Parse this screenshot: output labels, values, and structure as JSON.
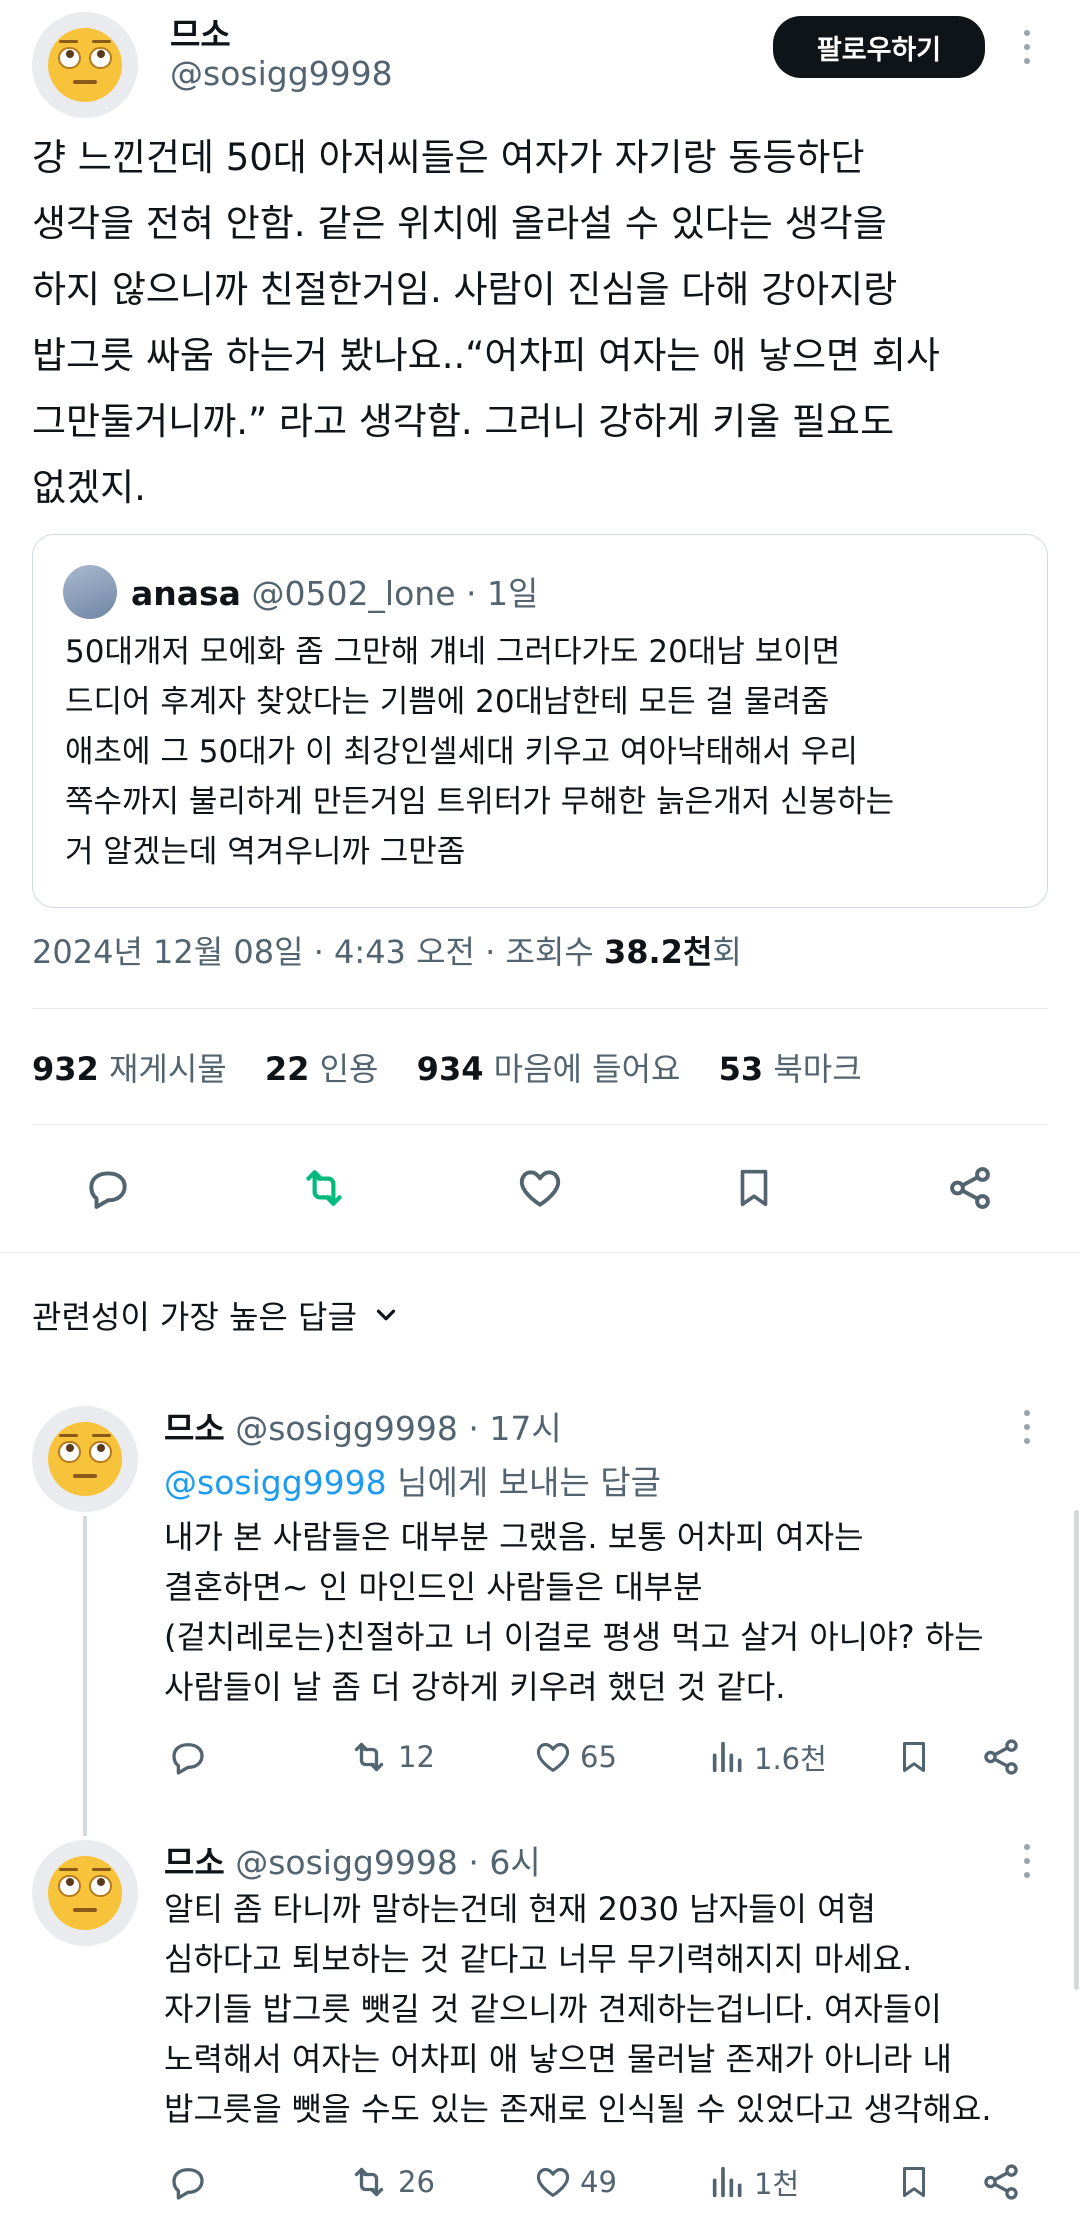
{
  "tweet": {
    "author_name": "므소",
    "author_handle": "@sosigg9998",
    "follow_label": "팔로우하기",
    "text": "걍 느낀건데 50대 아저씨들은 여자가 자기랑 동등하단 생각을 전혀 안함. 같은 위치에 올라설 수 있다는 생각을 하지 않으니까 친절한거임. 사람이 진심을 다해 강아지랑 밥그릇 싸움 하는거 봤나요..“어차피 여자는 애 낳으면 회사 그만둘거니까.” 라고 생각함. 그러니 강하게 키울 필요도 없겠지.",
    "text_lines": [
      "걍 느낀건데 50대 아저씨들은 여자가 자기랑 동등하단",
      "생각을 전혀 안함. 같은 위치에 올라설 수 있다는 생각을",
      "하지 않으니까 친절한거임. 사람이 진심을 다해 강아지랑",
      "밥그릇 싸움 하는거 봤나요..“어차피 여자는 애 낳으면 회사",
      "그만둘거니까.” 라고 생각함. 그러니 강하게 키울 필요도",
      "없겠지."
    ],
    "quote": {
      "name": "anasa",
      "handle": "@0502_lone",
      "time": "· 1일",
      "lines": [
        "50대개저 모에화 좀 그만해 걔네 그러다가도 20대남 보이면",
        "드디어 후계자 찾았다는 기쁨에 20대남한테 모든 걸 물려줌",
        "애초에 그 50대가 이 최강인셀세대 키우고 여아낙태해서 우리",
        "쪽수까지 불리하게 만든거임 트위터가 무해한 늙은개저 신봉하는",
        "거 알겠는데 역겨우니까 그만좀"
      ]
    },
    "meta_date": "2024년 12월 08일 · 4:43 오전 · 조회수 ",
    "views_num": "38.2천",
    "views_suffix": "회",
    "stats": {
      "retweets_num": "932",
      "retweets_label": "재게시물",
      "quotes_num": "22",
      "quotes_label": "인용",
      "likes_num": "934",
      "likes_label": "마음에 들어요",
      "bookmarks_num": "53",
      "bookmarks_label": "북마크"
    }
  },
  "replies_header": "관련성이 가장 높은 답글",
  "replies": [
    {
      "name": "므소",
      "handle": "@sosigg9998",
      "time": "· 17시",
      "reply_to_handle": "@sosigg9998",
      "reply_to_suffix": " 님에게 보내는 답글",
      "lines": [
        "내가 본 사람들은 대부분 그랬음. 보통 어차피 여자는",
        "결혼하면~ 인 마인드인 사람들은 대부분",
        "(겉치레로는)친절하고 너 이걸로 평생 먹고 살거 아니야? 하는",
        "사람들이 날 좀 더 강하게 키우려 했던 것 같다."
      ],
      "retweets": "12",
      "likes": "65",
      "views": "1.6천"
    },
    {
      "name": "므소",
      "handle": "@sosigg9998",
      "time": "· 6시",
      "lines": [
        "알티 좀 타니까 말하는건데 현재 2030 남자들이 여혐",
        "심하다고 퇴보하는 것 같다고 너무 무기력해지지 마세요.",
        "자기들 밥그릇 뺏길 것 같으니까 견제하는겁니다. 여자들이",
        "노력해서 여자는 어차피 애 낳으면 물러날 존재가 아니라 내",
        "밥그릇을 뺏을 수도 있는 존재로 인식될 수 있었다고 생각해요."
      ],
      "retweets": "26",
      "likes": "49",
      "views": "1천"
    }
  ],
  "colors": {
    "accent": "#1d9bf0",
    "retweet_green": "#00ba7c",
    "text": "#0f1419",
    "muted": "#536471"
  },
  "icons": [
    "reply-icon",
    "retweet-icon",
    "like-icon",
    "bookmark-icon",
    "share-icon",
    "views-icon",
    "chevron-down-icon",
    "more-icon"
  ]
}
